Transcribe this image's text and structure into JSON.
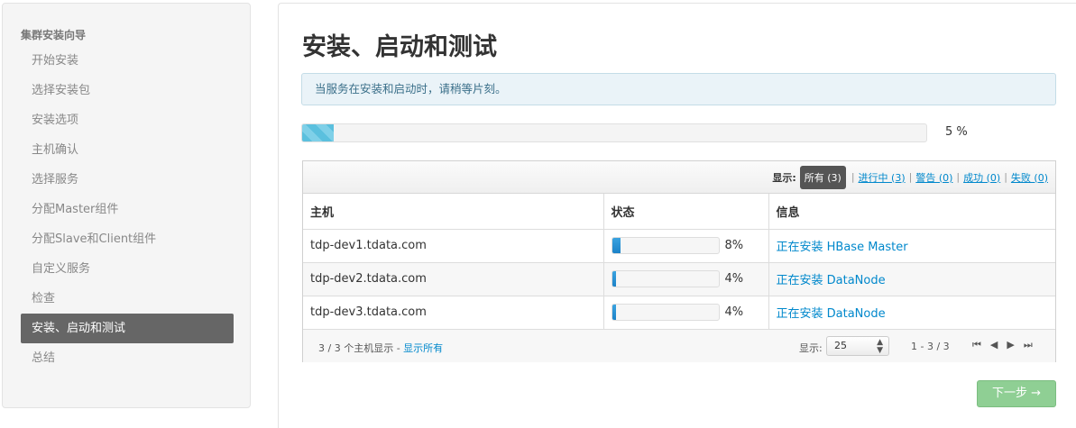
{
  "sidebar": {
    "heading": "集群安装向导",
    "items": [
      {
        "label": "开始安装",
        "active": false
      },
      {
        "label": "选择安装包",
        "active": false
      },
      {
        "label": "安装选项",
        "active": false
      },
      {
        "label": "主机确认",
        "active": false
      },
      {
        "label": "选择服务",
        "active": false
      },
      {
        "label": "分配Master组件",
        "active": false
      },
      {
        "label": "分配Slave和Client组件",
        "active": false
      },
      {
        "label": "自定义服务",
        "active": false
      },
      {
        "label": "检查",
        "active": false
      },
      {
        "label": "安装、启动和测试",
        "active": true
      },
      {
        "label": "总结",
        "active": false
      }
    ]
  },
  "main": {
    "title": "安装、启动和测试",
    "alert": "当服务在安装和启动时，请稍等片刻。",
    "overall_progress": 5,
    "overall_progress_label": "5 %",
    "filter": {
      "label": "显示:",
      "all": "所有 (3)",
      "in_progress": "进行中 (3)",
      "warning": "警告 (0)",
      "success": "成功 (0)",
      "failed": "失败 (0)",
      "sep": "|"
    },
    "table": {
      "headers": [
        "主机",
        "状态",
        "信息"
      ],
      "rows": [
        {
          "host": "tdp-dev1.tdata.com",
          "progress": 8,
          "progress_label": "8%",
          "info": "正在安装 HBase Master"
        },
        {
          "host": "tdp-dev2.tdata.com",
          "progress": 4,
          "progress_label": "4%",
          "info": "正在安装 DataNode"
        },
        {
          "host": "tdp-dev3.tdata.com",
          "progress": 4,
          "progress_label": "4%",
          "info": "正在安装 DataNode"
        }
      ]
    },
    "footer": {
      "summary": "3 / 3 个主机显示 - ",
      "show_all": "显示所有",
      "show_label": "显示:",
      "page_size": "25",
      "range": "1 - 3 / 3"
    },
    "next_button": "下一步 →"
  },
  "colors": {
    "progress": "#5bc0de",
    "mini_progress": "#1c82c8",
    "next_button": "#8fcf94",
    "active_nav": "#666666"
  }
}
